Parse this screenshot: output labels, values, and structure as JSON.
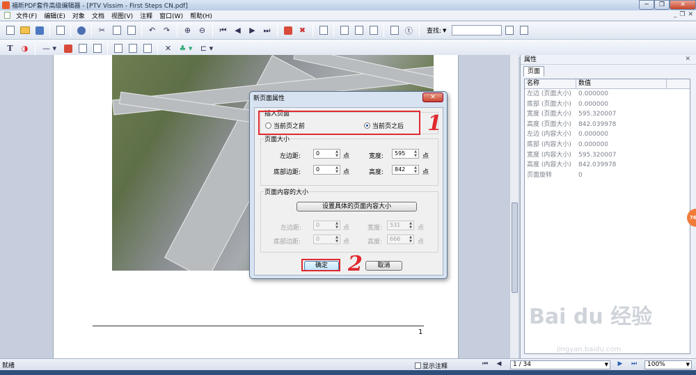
{
  "window": {
    "title": "福昕PDF套件高级编辑器 - [PTV Vissim - First Steps CN.pdf]",
    "minimize": "─",
    "restore": "❐",
    "close": "✕"
  },
  "menu": {
    "items": [
      "文件(F)",
      "编辑(E)",
      "对象",
      "文档",
      "视图(V)",
      "注释",
      "窗口(W)",
      "帮助(H)"
    ],
    "mdi_min": "_",
    "mdi_restore": "❐",
    "mdi_close": "✕"
  },
  "toolbar": {
    "find_label": "查找:"
  },
  "page": {
    "number": "1"
  },
  "dialog": {
    "title": "新页面属性",
    "close": "✕",
    "insert_group": "插入页面",
    "radio_before": "当前页之前",
    "radio_after": "当前页之后",
    "radio_selected": "after",
    "size_group": "页面大小",
    "left_margin_label": "左边距:",
    "left_margin_value": "0",
    "bottom_margin_label": "底部边距:",
    "bottom_margin_value": "0",
    "width_label": "宽度:",
    "width_value": "595",
    "height_label": "高度:",
    "height_value": "842",
    "unit": "点",
    "content_group": "页面内容的大小",
    "content_button": "设置具体的页面内容大小",
    "c_left_label": "左边距:",
    "c_left_value": "0",
    "c_bottom_label": "底部边距:",
    "c_bottom_value": "0",
    "c_width_label": "宽度:",
    "c_width_value": "531",
    "c_height_label": "高度:",
    "c_height_value": "666",
    "ok": "确定",
    "cancel": "取消"
  },
  "annotations": {
    "mark1": "1",
    "mark2": "2",
    "color": "#e0282e"
  },
  "props": {
    "title": "属性",
    "close": "✕",
    "tab": "页面",
    "col_name": "名称",
    "col_value": "数值",
    "rows": [
      {
        "name": "左边 (页面大小)",
        "value": "0.000000"
      },
      {
        "name": "底部 (页面大小)",
        "value": "0.000000"
      },
      {
        "name": "宽度 (页面大小)",
        "value": "595.320007"
      },
      {
        "name": "高度 (页面大小)",
        "value": "842.039978"
      },
      {
        "name": "左边 (内容大小)",
        "value": "0.000000"
      },
      {
        "name": "底部 (内容大小)",
        "value": "0.000000"
      },
      {
        "name": "宽度 (内容大小)",
        "value": "595.320007"
      },
      {
        "name": "高度 (内容大小)",
        "value": "842.039978"
      },
      {
        "name": "页面旋转",
        "value": "0"
      }
    ],
    "badge": "76"
  },
  "watermark": {
    "text": "Bai du 经验",
    "sub": "jingyan.baidu.com"
  },
  "status": {
    "ready": "就绪",
    "show_comments": "显示注释",
    "page": "1 / 34",
    "zoom": "100%"
  }
}
